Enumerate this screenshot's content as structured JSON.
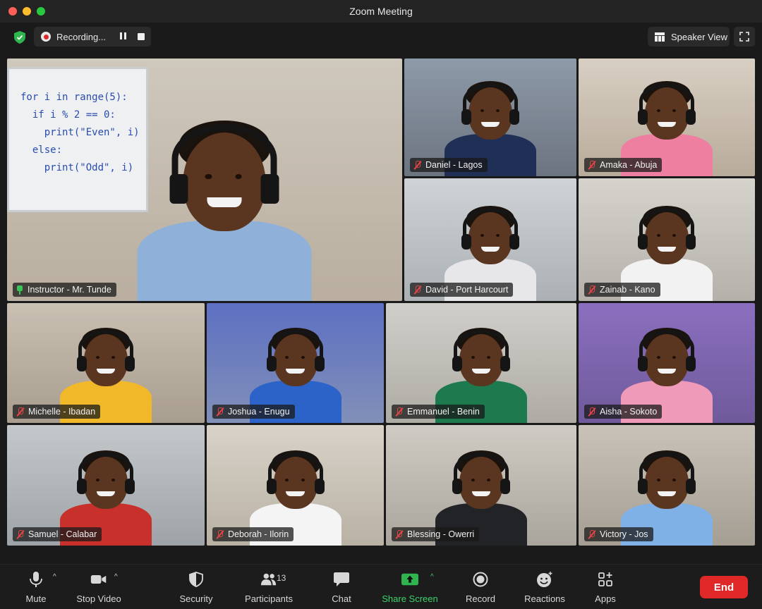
{
  "window": {
    "title": "Zoom Meeting"
  },
  "topbar": {
    "recording_label": "Recording...",
    "speaker_view_label": "Speaker View"
  },
  "whiteboard": {
    "code_lines": [
      "for i in range(5):",
      "  if i % 2 == 0:",
      "    print(\"Even\", i)",
      "  else:",
      "    print(\"Odd\", i)"
    ]
  },
  "participants": [
    {
      "name": "Instructor - Mr. Tunde",
      "status": "pinned",
      "shirt": "#8fb0d8"
    },
    {
      "name": "Daniel - Lagos",
      "status": "muted",
      "shirt": "#1f2f55"
    },
    {
      "name": "Amaka - Abuja",
      "status": "muted",
      "shirt": "#ee7fa0"
    },
    {
      "name": "David - Port Harcourt",
      "status": "muted",
      "shirt": "#e7e7ea"
    },
    {
      "name": "Zainab - Kano",
      "status": "muted",
      "shirt": "#f2f2f2"
    },
    {
      "name": "Michelle - Ibadan",
      "status": "muted",
      "shirt": "#f1b92a"
    },
    {
      "name": "Joshua - Enugu",
      "status": "muted",
      "shirt": "#2c63c8"
    },
    {
      "name": "Emmanuel - Benin",
      "status": "muted",
      "shirt": "#1d7a4f"
    },
    {
      "name": "Aisha - Sokoto",
      "status": "muted",
      "shirt": "#ef9ab8"
    },
    {
      "name": "Samuel - Calabar",
      "status": "muted",
      "shirt": "#c8302b"
    },
    {
      "name": "Deborah - Ilorin",
      "status": "muted",
      "shirt": "#f4f4f4"
    },
    {
      "name": "Blessing - Owerri",
      "status": "muted",
      "shirt": "#222327"
    },
    {
      "name": "Victory - Jos",
      "status": "muted",
      "shirt": "#7fb0e6"
    }
  ],
  "toolbar": {
    "mute": "Mute",
    "stop_video": "Stop Video",
    "security": "Security",
    "participants": "Participants",
    "participants_count": "13",
    "chat": "Chat",
    "share_screen": "Share Screen",
    "record": "Record",
    "reactions": "Reactions",
    "apps": "Apps",
    "end": "End"
  },
  "colors": {
    "accent_green": "#3bd26b",
    "end_red": "#e02828",
    "muted_red": "#e64545"
  }
}
